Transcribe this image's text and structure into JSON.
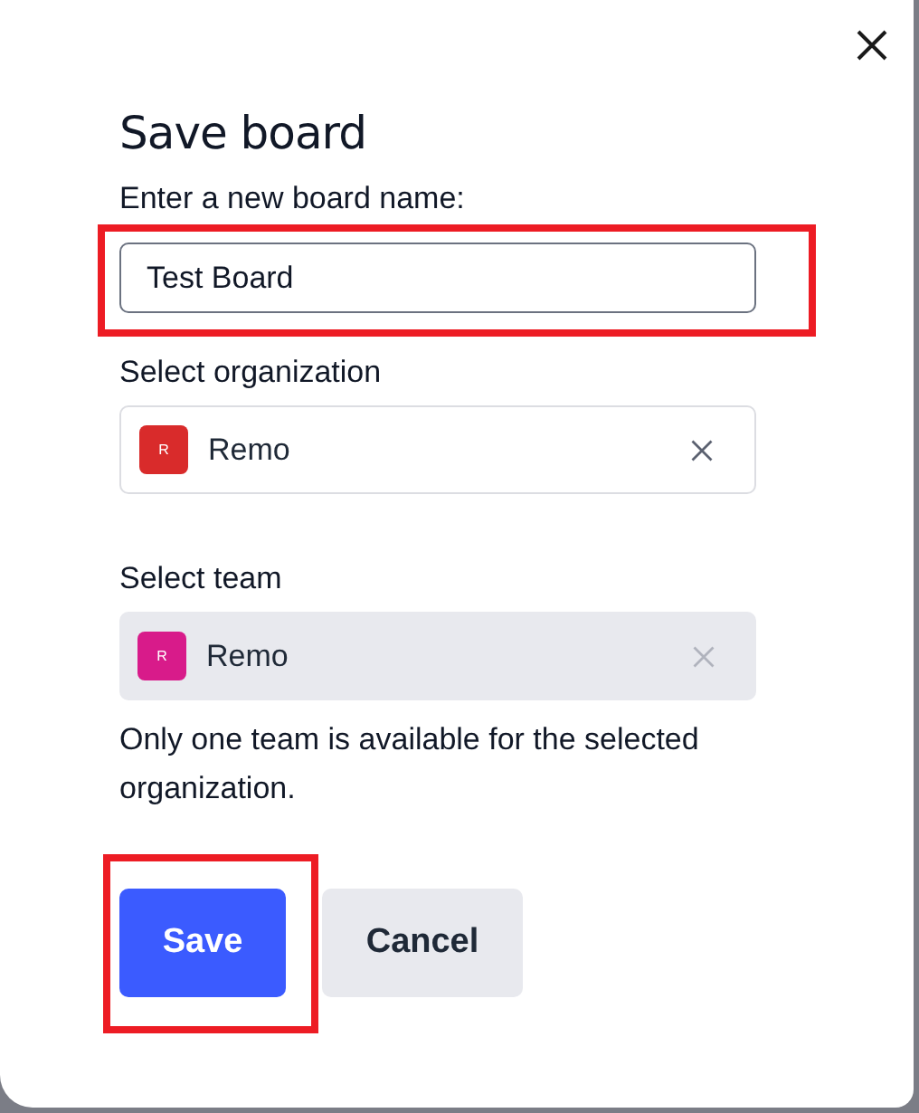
{
  "dialog": {
    "title": "Save board",
    "name_field": {
      "label": "Enter a new board name:",
      "value": "Test Board",
      "highlighted": true
    },
    "selects": [
      {
        "label": "Select organization",
        "avatar": "R",
        "color": "#d92b2b",
        "value": "Remo",
        "disabled": false
      },
      {
        "label": "Select team",
        "avatar": "R",
        "color": "#d81b8a",
        "value": "Remo",
        "disabled": true
      }
    ],
    "helper_text": "Only one team is available for the selected organization.",
    "buttons": [
      {
        "kind": "primary",
        "label": "Save",
        "highlighted": true
      },
      {
        "kind": "secondary",
        "label": "Cancel",
        "highlighted": false
      }
    ]
  }
}
